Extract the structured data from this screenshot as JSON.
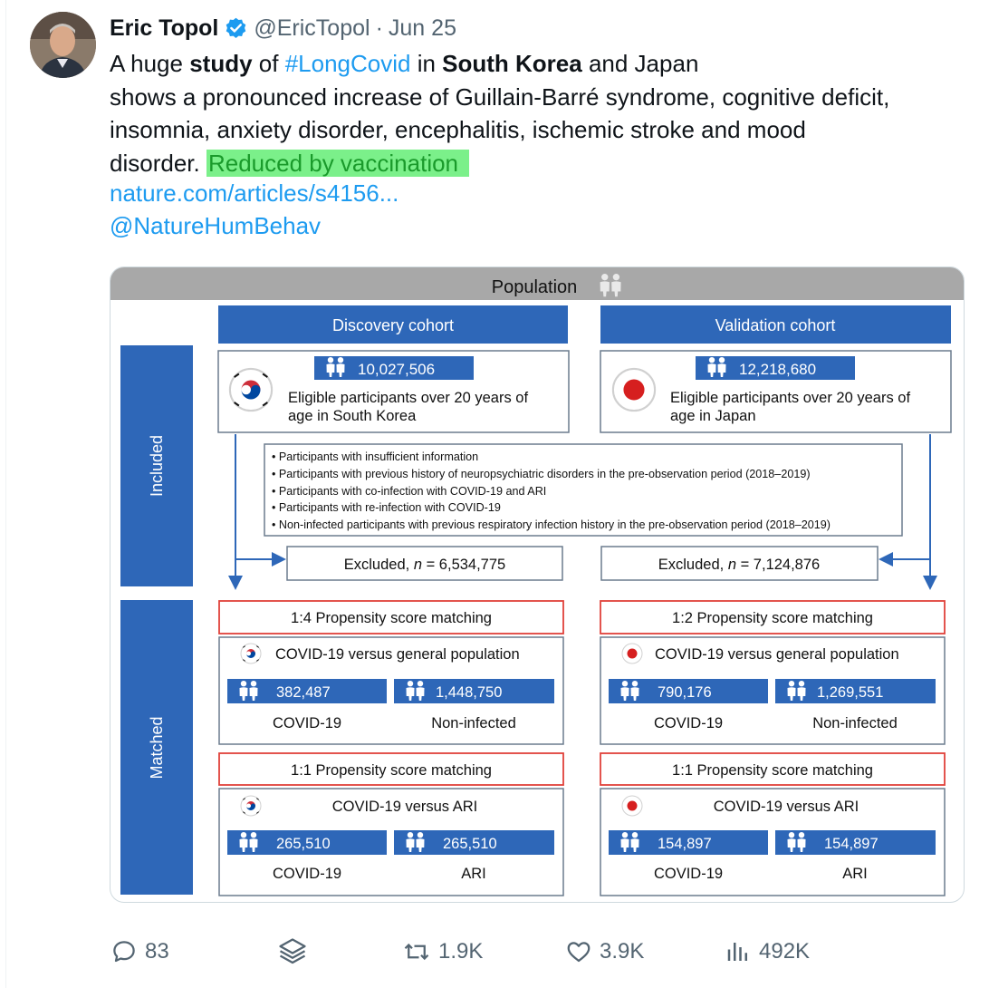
{
  "tweet": {
    "author_name": "Eric Topol",
    "handle": "@EricTopol",
    "separator": "·",
    "date": "Jun 25",
    "text": {
      "p1": "A huge ",
      "b1": "study",
      "p2": " of ",
      "hashtag": "#LongCovid",
      "p3": " in ",
      "b2": "South Korea",
      "p4": " and Japan",
      "line2": "shows a pronounced increase of Guillain-Barré syndrome, cognitive deficit,",
      "line3": "insomnia, anxiety disorder, encephalitis, ischemic stroke and mood",
      "line4_prefix": "disorder. ",
      "highlight": "Reduced by vaccination"
    },
    "url": "nature.com/articles/s4156...",
    "mention": "@NatureHumBehav"
  },
  "figure": {
    "title": "Population",
    "side_labels": {
      "included": "Included",
      "matched": "Matched"
    },
    "exclusion_criteria": [
      "• Participants with insufficient information",
      "• Participants with previous history of neuropsychiatric disorders in the pre-observation period (2018–2019)",
      "• Participants with co-infection with COVID-19 and ARI",
      "• Participants with re-infection with COVID-19",
      "• Non-infected participants with previous respiratory infection history in the pre-observation period (2018–2019)"
    ],
    "excluded_prefix": "Excluded, ",
    "n_label": "n",
    "cohorts": [
      {
        "header": "Discovery cohort",
        "eligible_count": "10,027,506",
        "eligible_line1": "Eligible participants over 20 years of",
        "eligible_line2": "age in South Korea",
        "excluded": " = 6,534,775",
        "matching1": "1:4 Propensity score matching",
        "comparison1": "COVID-19 versus general population",
        "count_a1": "382,487",
        "label_a1": "COVID-19",
        "count_b1": "1,448,750",
        "label_b1": "Non-infected",
        "matching2": "1:1 Propensity score matching",
        "comparison2": "COVID-19 versus ARI",
        "count_a2": "265,510",
        "label_a2": "COVID-19",
        "count_b2": "265,510",
        "label_b2": "ARI"
      },
      {
        "header": "Validation cohort",
        "eligible_count": "12,218,680",
        "eligible_line1": "Eligible participants over 20 years of",
        "eligible_line2": "age in Japan",
        "excluded": " = 7,124,876",
        "matching1": "1:2 Propensity score matching",
        "comparison1": "COVID-19 versus general population",
        "count_a1": "790,176",
        "label_a1": "COVID-19",
        "count_b1": "1,269,551",
        "label_b1": "Non-infected",
        "matching2": "1:1 Propensity score matching",
        "comparison2": "COVID-19 versus ARI",
        "count_a2": "154,897",
        "label_a2": "COVID-19",
        "count_b2": "154,897",
        "label_b2": "ARI"
      }
    ],
    "colors": {
      "blue": "#2e67b8",
      "red": "#e0423a",
      "gray_header": "#a8a8a8",
      "highlight": "#7bf08a"
    }
  },
  "actions": {
    "replies": "83",
    "retweets": "1.9K",
    "likes": "3.9K",
    "views": "492K",
    "icons": [
      "reply-icon",
      "layers-icon",
      "retweet-icon",
      "like-icon",
      "views-icon"
    ]
  }
}
